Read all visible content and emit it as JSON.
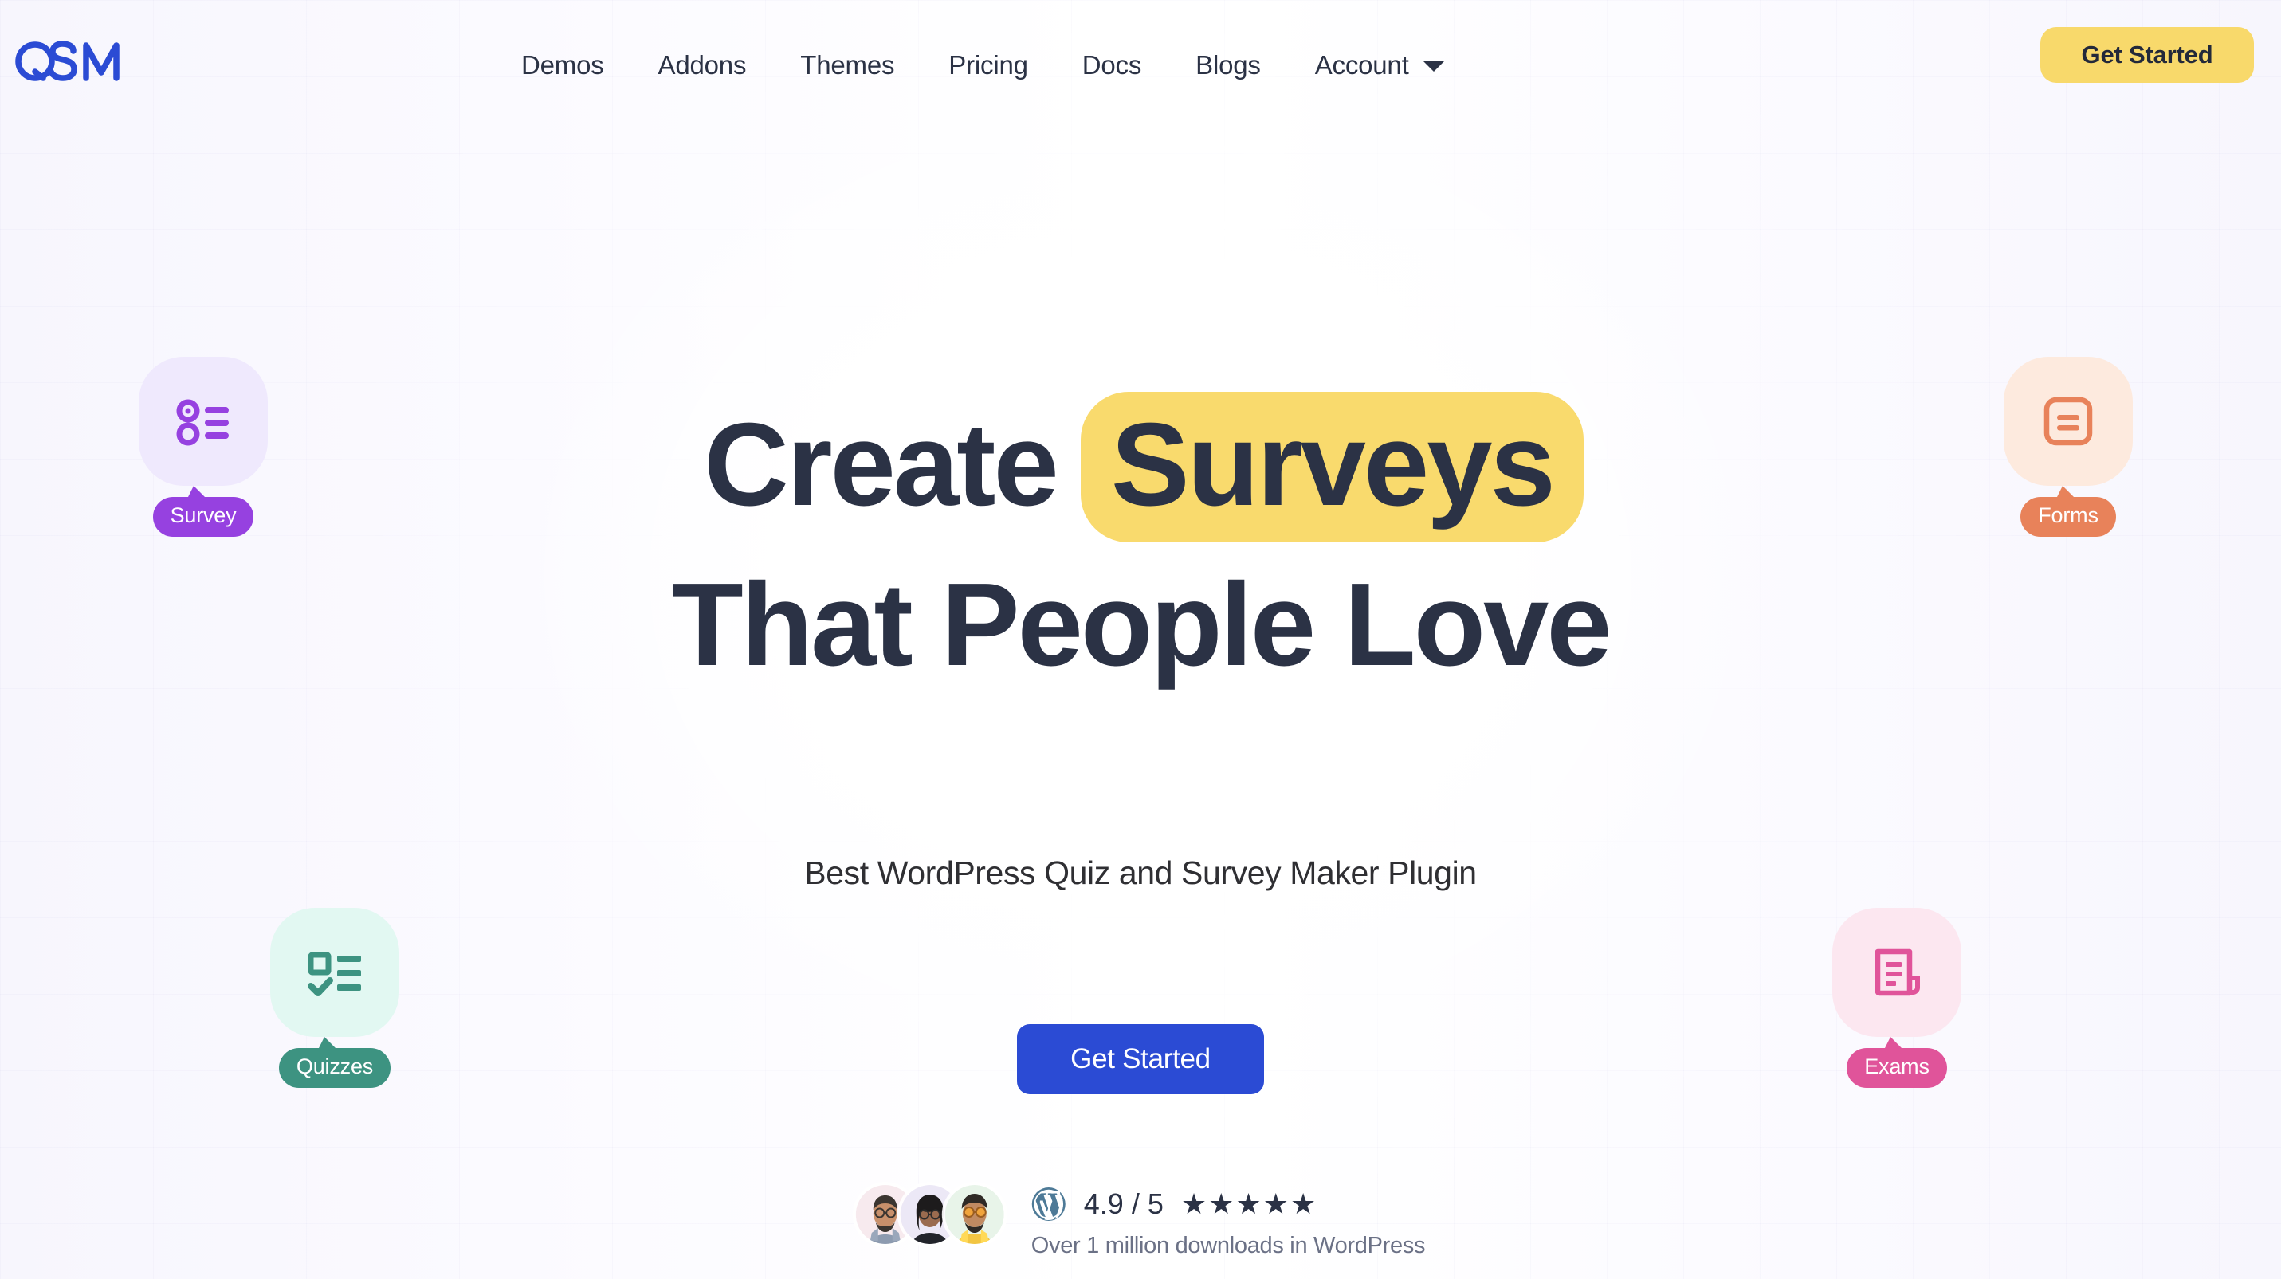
{
  "brand": {
    "name": "QSM",
    "logo_color": "#2b4bd4"
  },
  "header": {
    "nav_items": [
      {
        "label": "Demos",
        "name": "nav-demos"
      },
      {
        "label": "Addons",
        "name": "nav-addons"
      },
      {
        "label": "Themes",
        "name": "nav-themes"
      },
      {
        "label": "Pricing",
        "name": "nav-pricing"
      },
      {
        "label": "Docs",
        "name": "nav-docs"
      },
      {
        "label": "Blogs",
        "name": "nav-blogs"
      }
    ],
    "account": {
      "label": "Account",
      "caret_icon": "chevron-down-icon"
    },
    "cta_label": "Get Started",
    "cta_color": "#f8d96b"
  },
  "hero": {
    "headline_line1_prefix": "Create",
    "headline_highlight": "Surveys",
    "headline_line2": "That People Love",
    "highlight_color": "#f9da6d",
    "subtitle": "Best WordPress Quiz and Survey Maker Plugin",
    "cta_label": "Get Started",
    "cta_color": "#2b4bd4",
    "text_color": "#2b3245"
  },
  "feature_badges": [
    {
      "label": "Survey",
      "icon": "radio-list-icon",
      "accent": "#9641e0",
      "tint": "#efe9fd"
    },
    {
      "label": "Quizzes",
      "icon": "checklist-icon",
      "accent": "#3d9381",
      "tint": "#e2f8f2"
    },
    {
      "label": "Forms",
      "icon": "form-document-icon",
      "accent": "#e8825a",
      "tint": "#fdeade"
    },
    {
      "label": "Exams",
      "icon": "exam-paper-icon",
      "accent": "#e0549a",
      "tint": "#fce7f0"
    }
  ],
  "social_proof": {
    "avatars": [
      {
        "name": "avatar-user-1",
        "tint": "#f7eaee"
      },
      {
        "name": "avatar-user-2",
        "tint": "#ece8f6"
      },
      {
        "name": "avatar-user-3",
        "tint": "#e8f4e9"
      }
    ],
    "wordpress_icon": "wordpress-icon",
    "rating_score": "4.9 / 5",
    "stars": "★★★★★",
    "star_count": 5,
    "downloads_note": "Over 1 million downloads in WordPress"
  }
}
